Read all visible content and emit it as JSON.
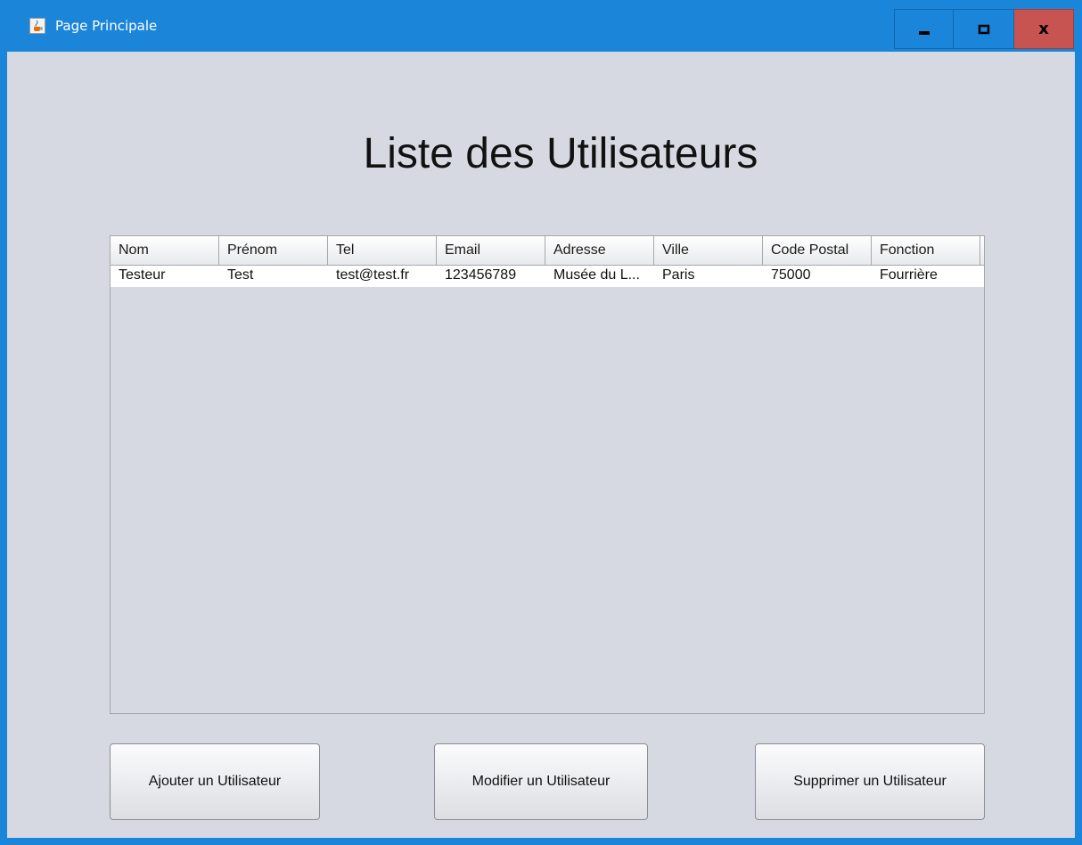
{
  "window": {
    "title": "Page Principale",
    "icon": "java-cup-icon",
    "controls": {
      "minimize": "▁",
      "maximize": "□",
      "close": "x"
    },
    "colors": {
      "titlebar": "#1b86d9",
      "close": "#c75450",
      "background": "#d6d9e1"
    }
  },
  "main": {
    "heading": "Liste des Utilisateurs",
    "table": {
      "columns": [
        "Nom",
        "Prénom",
        "Tel",
        "Email",
        "Adresse",
        "Ville",
        "Code Postal",
        "Fonction"
      ],
      "rows": [
        [
          "Testeur",
          "Test",
          "test@test.fr",
          "123456789",
          "Musée du L...",
          "Paris",
          "75000",
          "Fourrière"
        ]
      ]
    },
    "buttons": {
      "add": "Ajouter un Utilisateur",
      "edit": "Modifier un Utilisateur",
      "delete": "Supprimer un Utilisateur"
    }
  }
}
